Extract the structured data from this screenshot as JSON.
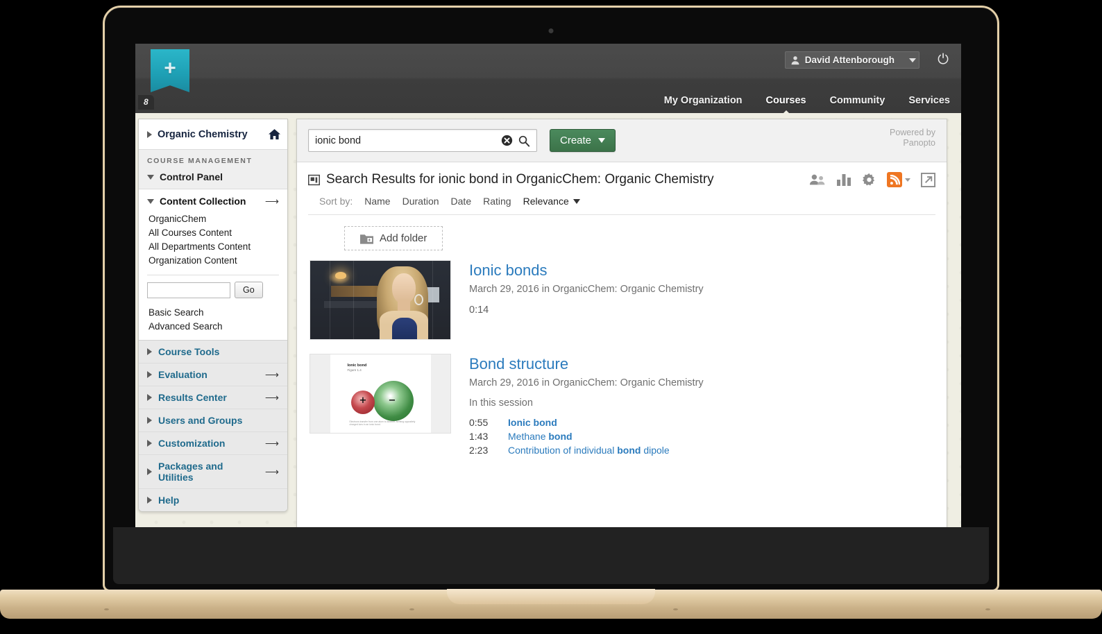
{
  "topbar": {
    "logo_icon": "blackboard-plus-logo",
    "corner_tag": "8",
    "user": {
      "name": "David Attenborough",
      "icon": "user-avatar-icon",
      "caret_icon": "chevron-down-icon"
    },
    "power_icon": "power-icon",
    "nav": [
      {
        "label": "My Organization",
        "active": false
      },
      {
        "label": "Courses",
        "active": true
      },
      {
        "label": "Community",
        "active": false
      },
      {
        "label": "Services",
        "active": false
      }
    ]
  },
  "sidebar": {
    "course": {
      "label": "Organic Chemistry",
      "expand_icon": "triangle-right-icon",
      "home_icon": "home-icon"
    },
    "section_title": "COURSE MANAGEMENT",
    "control_panel": {
      "label": "Control Panel",
      "expand_icon": "triangle-down-icon"
    },
    "content_collection": {
      "label": "Content Collection",
      "expand_icon": "triangle-down-icon",
      "go_icon": "arrow-right-icon"
    },
    "content_links": [
      "OrganicChem",
      "All Courses Content",
      "All Departments Content",
      "Organization Content"
    ],
    "search": {
      "value": "",
      "placeholder": "",
      "go_label": "Go"
    },
    "search_links": [
      "Basic Search",
      "Advanced Search"
    ],
    "tools": [
      {
        "label": "Course Tools",
        "has_arrow": false
      },
      {
        "label": "Evaluation",
        "has_arrow": true
      },
      {
        "label": "Results Center",
        "has_arrow": true
      },
      {
        "label": "Users and Groups",
        "has_arrow": false
      },
      {
        "label": "Customization",
        "has_arrow": true
      },
      {
        "label": "Packages and Utilities",
        "has_arrow": true
      },
      {
        "label": "Help",
        "has_arrow": false
      }
    ]
  },
  "search_panel": {
    "query": "ionic bond",
    "placeholder": "Search",
    "clear_icon": "clear-circle-icon",
    "search_icon": "magnifier-icon",
    "create_label": "Create",
    "create_caret_icon": "caret-down-icon",
    "powered_line1": "Powered by",
    "powered_line2": "Panopto",
    "accent_green": "#3c7349"
  },
  "results_header": {
    "icon": "folder-window-icon",
    "prefix": "Search Results for ",
    "query": "ionic bond",
    "middle": " in ",
    "scope": "OrganicChem: Organic Chemistry",
    "actions": [
      {
        "name": "share-users-icon",
        "label": "Share"
      },
      {
        "name": "stats-bar-chart-icon",
        "label": "Statistics"
      },
      {
        "name": "gear-icon",
        "label": "Settings"
      },
      {
        "name": "rss-feed-icon",
        "label": "Subscribe",
        "color": "#ef7622"
      },
      {
        "name": "open-external-icon",
        "label": "Open"
      }
    ]
  },
  "sort": {
    "label": "Sort by:",
    "options": [
      "Name",
      "Duration",
      "Date",
      "Rating"
    ],
    "selected": "Relevance",
    "caret_icon": "caret-down-icon"
  },
  "add_folder": {
    "label": "Add folder",
    "icon": "add-folder-icon"
  },
  "results": [
    {
      "title": "Ionic bonds",
      "meta": "March 29, 2016 in OrganicChem: Organic Chemistry",
      "duration": "0:14",
      "thumb_kind": "video-still",
      "timestamps": []
    },
    {
      "title": "Bond structure",
      "meta": "March 29, 2016 in OrganicChem: Organic Chemistry",
      "session_label": "In this session",
      "thumb_kind": "slide",
      "thumb_slide": {
        "title": "Ionic bond",
        "subtitle": "Figure 1.4",
        "caption": "Electrons transfer from one atom to another, forming oppositely charged ions in an ionic bond.",
        "positive_sign": "+",
        "negative_sign": "−"
      },
      "timestamps": [
        {
          "time": "0:55",
          "pre": "",
          "match": "Ionic bond",
          "post": ""
        },
        {
          "time": "1:43",
          "pre": "Methane ",
          "match": "bond",
          "post": ""
        },
        {
          "time": "2:23",
          "pre": "Contribution of individual ",
          "match": "bond",
          "post": " dipole"
        }
      ]
    }
  ]
}
